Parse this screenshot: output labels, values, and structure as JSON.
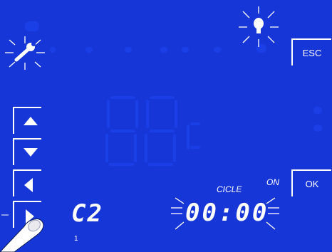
{
  "display": {
    "background": "#1636d8",
    "icons": {
      "wrench": "wrench-icon",
      "bulb": "lightbulb-icon",
      "hand": "pointing-hand-icon"
    },
    "buttons": {
      "esc_label": "ESC",
      "ok_label": "OK",
      "up": "up-arrow-icon",
      "down": "down-arrow-icon",
      "left": "left-arrow-icon",
      "right": "right-arrow-icon"
    },
    "program": "C2",
    "program_index": "1",
    "cycle_label": "CICLE",
    "on_label": "ON",
    "time": "00:00"
  }
}
